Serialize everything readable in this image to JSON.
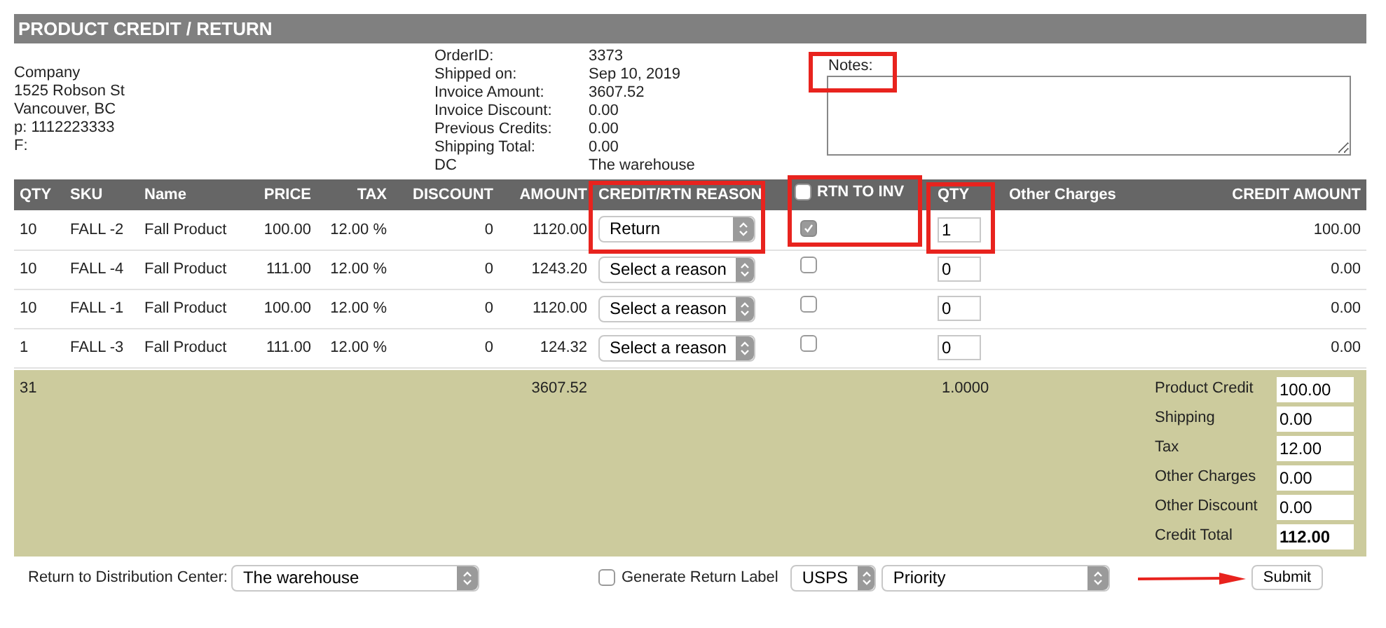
{
  "title": "PRODUCT CREDIT / RETURN",
  "customer": [
    "Company",
    "1525 Robson St",
    "Vancouver, BC",
    "p: 1112223333",
    "F:"
  ],
  "order_info": [
    {
      "label": "OrderID:",
      "value": "3373"
    },
    {
      "label": "Shipped on:",
      "value": "Sep 10, 2019"
    },
    {
      "label": "Invoice Amount:",
      "value": "3607.52"
    },
    {
      "label": "Invoice Discount:",
      "value": "0.00"
    },
    {
      "label": "Previous Credits:",
      "value": "0.00"
    },
    {
      "label": "Shipping Total:",
      "value": "0.00"
    },
    {
      "label": "DC",
      "value": "The warehouse"
    }
  ],
  "notes": {
    "label": "Notes:"
  },
  "table": {
    "columns": [
      "QTY",
      "SKU",
      "Name",
      "PRICE",
      "TAX",
      "DISCOUNT",
      "AMOUNT",
      "CREDIT/RTN REASON",
      "RTN TO INV",
      "QTY",
      "Other Charges",
      "CREDIT AMOUNT"
    ],
    "rtn_all_checked": false,
    "rows": [
      {
        "qty": "10",
        "sku": "FALL -2",
        "name": "Fall Product",
        "price": "100.00",
        "tax": "12.00 %",
        "discount": "0",
        "amount": "1120.00",
        "reason": "Return",
        "rtn_to_inv": true,
        "return_qty": "1",
        "credit_amount": "100.00"
      },
      {
        "qty": "10",
        "sku": "FALL -4",
        "name": "Fall Product",
        "price": "111.00",
        "tax": "12.00 %",
        "discount": "0",
        "amount": "1243.20",
        "reason": "Select a reason",
        "rtn_to_inv": false,
        "return_qty": "0",
        "credit_amount": "0.00"
      },
      {
        "qty": "10",
        "sku": "FALL -1",
        "name": "Fall Product",
        "price": "100.00",
        "tax": "12.00 %",
        "discount": "0",
        "amount": "1120.00",
        "reason": "Select a reason",
        "rtn_to_inv": false,
        "return_qty": "0",
        "credit_amount": "0.00"
      },
      {
        "qty": "1",
        "sku": "FALL -3",
        "name": "Fall Product",
        "price": "111.00",
        "tax": "12.00 %",
        "discount": "0",
        "amount": "124.32",
        "reason": "Select a reason",
        "rtn_to_inv": false,
        "return_qty": "0",
        "credit_amount": "0.00"
      }
    ]
  },
  "totals": {
    "qty": "31",
    "amount": "3607.52",
    "return_qty": "1.0000",
    "summary": [
      {
        "label": "Product Credit",
        "value": "100.00",
        "bold": false
      },
      {
        "label": "Shipping",
        "value": "0.00",
        "bold": false
      },
      {
        "label": "Tax",
        "value": "12.00",
        "bold": false
      },
      {
        "label": "Other Charges",
        "value": "0.00",
        "bold": false
      },
      {
        "label": "Other Discount",
        "value": "0.00",
        "bold": false
      },
      {
        "label": "Credit Total",
        "value": "112.00",
        "bold": true
      }
    ]
  },
  "footer": {
    "dc_label": "Return to Distribution Center:",
    "dc_value": "The warehouse",
    "generate_label": "Generate Return Label",
    "generate_checked": false,
    "carrier": "USPS",
    "service": "Priority",
    "submit": "Submit"
  }
}
